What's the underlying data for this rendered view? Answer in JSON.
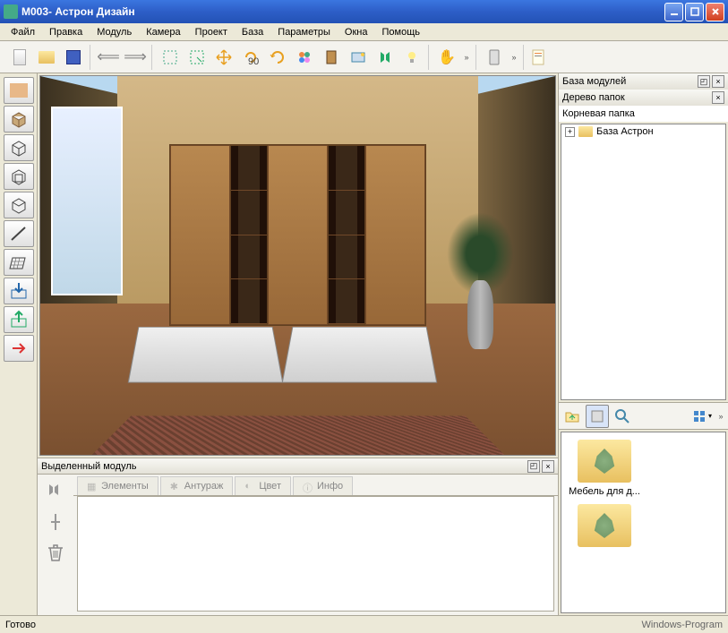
{
  "titlebar": {
    "title": "М003- Астрон Дизайн"
  },
  "menu": {
    "items": [
      "Файл",
      "Правка",
      "Модуль",
      "Камера",
      "Проект",
      "База",
      "Параметры",
      "Окна",
      "Помощь"
    ]
  },
  "panels": {
    "modules_db": "База модулей",
    "folder_tree": "Дерево папок",
    "root_folder": "Корневая папка",
    "tree_item": "База Астрон",
    "selected_module": "Выделенный модуль"
  },
  "module_tabs": {
    "elements": "Элементы",
    "entourage": "Антураж",
    "color": "Цвет",
    "info": "Инфо"
  },
  "folder_items": {
    "item1": "Мебель для д..."
  },
  "status": {
    "text": "Готово",
    "watermark": "Windows-Program"
  },
  "toolbar_icons": {
    "new": "new-file-icon",
    "open": "open-folder-icon",
    "save": "save-icon",
    "undo": "undo-icon",
    "redo": "redo-icon",
    "select": "select-icon",
    "select_green": "select-tool-icon",
    "move": "move-icon",
    "rotate90": "rotate-90-icon",
    "rotate": "rotate-icon",
    "colors": "color-palette-icon",
    "door": "door-icon",
    "render": "render-icon",
    "mirror": "mirror-icon",
    "light": "light-icon",
    "pan": "pan-hand-icon",
    "phone": "phone-icon",
    "doc": "document-icon"
  },
  "left_tools": [
    "material",
    "box",
    "cube",
    "cube2",
    "cube3",
    "line",
    "plane",
    "import",
    "export",
    "arrow-right"
  ]
}
